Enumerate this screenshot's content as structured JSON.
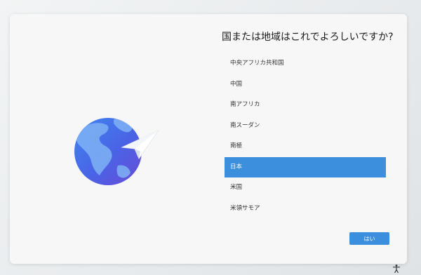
{
  "title": "国または地域はこれでよろしいですか?",
  "regions": [
    {
      "label": "中央アフリカ共和国",
      "selected": false
    },
    {
      "label": "中国",
      "selected": false
    },
    {
      "label": "南アフリカ",
      "selected": false
    },
    {
      "label": "南スーダン",
      "selected": false
    },
    {
      "label": "南極",
      "selected": false
    },
    {
      "label": "日本",
      "selected": true
    },
    {
      "label": "米国",
      "selected": false
    },
    {
      "label": "米領サモア",
      "selected": false
    }
  ],
  "buttons": {
    "yes_label": "はい"
  },
  "colors": {
    "accent": "#3b8fdc",
    "background": "#f7f7f7"
  },
  "icons": {
    "illustration": "globe-with-paper-plane-icon",
    "accessibility": "accessibility-icon"
  }
}
